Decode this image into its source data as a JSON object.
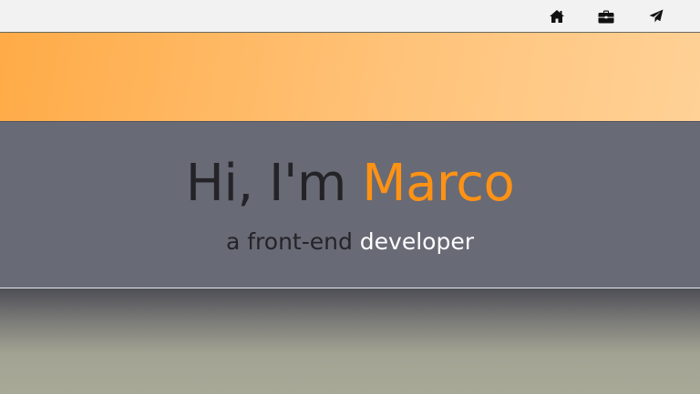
{
  "nav": {
    "items": [
      {
        "icon": "home-icon",
        "name": "nav-home"
      },
      {
        "icon": "briefcase-icon",
        "name": "nav-work"
      },
      {
        "icon": "paper-plane-icon",
        "name": "nav-contact"
      }
    ]
  },
  "hero": {
    "greeting": "Hi, I'm ",
    "name": "Marco",
    "role_prefix": "a front-end ",
    "role": "developer"
  },
  "colors": {
    "accent": "#ff9214",
    "hero_bg": "#686a76",
    "nav_bg": "#f2f2f2",
    "text_dark": "#242428",
    "text_light": "#ffffff"
  }
}
